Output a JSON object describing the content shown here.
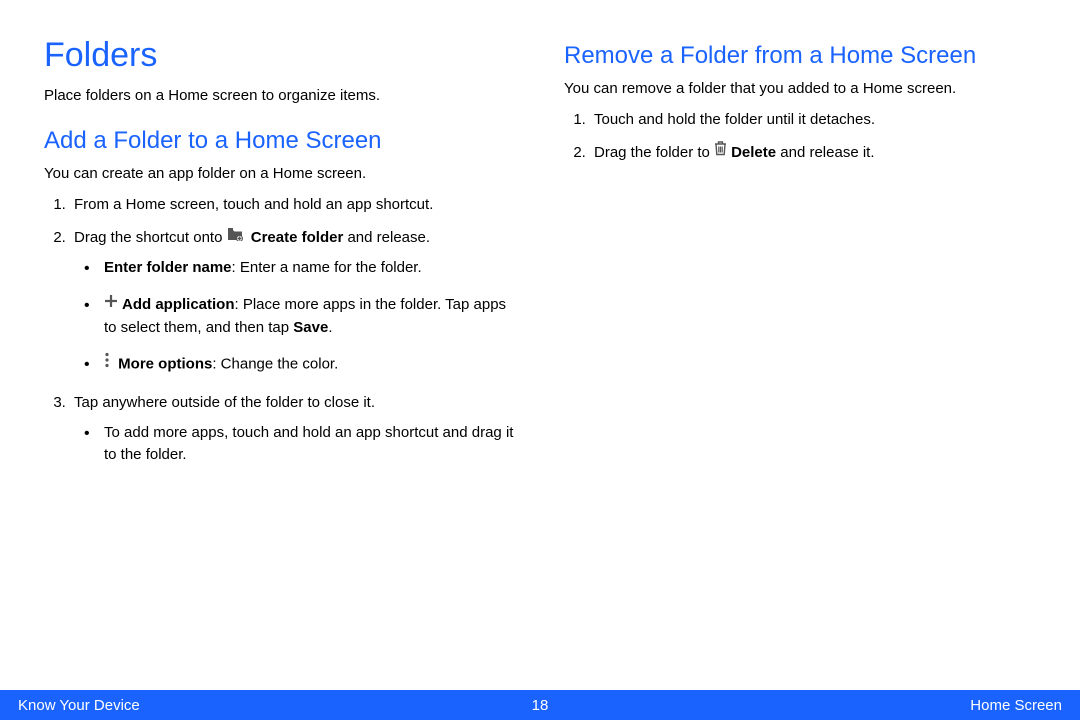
{
  "left": {
    "h1": "Folders",
    "intro": "Place folders on a Home screen to organize items.",
    "h2": "Add a Folder to a Home Screen",
    "p1": "You can create an app folder on a Home screen.",
    "step1": "From a Home screen, touch and hold an app shortcut.",
    "step2a": "Drag the shortcut onto ",
    "step2b_bold": "Create folder",
    "step2c": " and release.",
    "b1_bold": "Enter folder name",
    "b1_rest": ": Enter a name for the folder.",
    "b2_bold": "Add application",
    "b2_rest": ": Place more apps in the folder. Tap apps to select them, and then tap ",
    "b2_save": "Save",
    "b2_period": ".",
    "b3_bold": "More options",
    "b3_rest": ": Change the color.",
    "step3": "Tap anywhere outside of the folder to close it.",
    "b4": "To add more apps, touch and hold an app shortcut and drag it to the folder."
  },
  "right": {
    "h2": "Remove a Folder from a Home Screen",
    "p1": "You can remove a folder that you added to a Home screen.",
    "step1": "Touch and hold the folder until it detaches.",
    "step2a": "Drag the folder to ",
    "step2b_bold": "Delete",
    "step2c": "  and release it."
  },
  "footer": {
    "left": "Know Your Device",
    "center": "18",
    "right": "Home Screen"
  }
}
